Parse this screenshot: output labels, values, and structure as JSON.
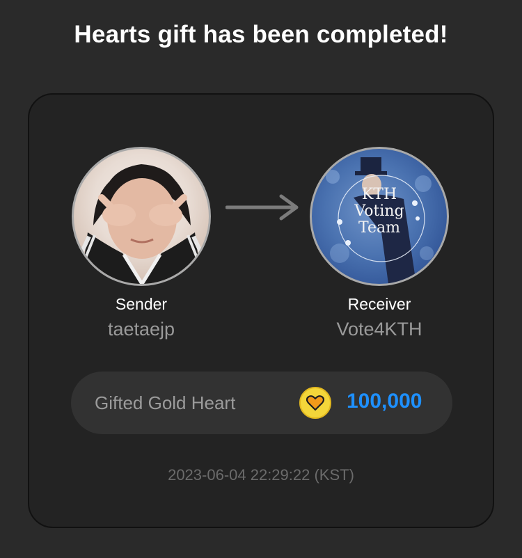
{
  "header": {
    "title": "Hearts gift has been completed!"
  },
  "sender": {
    "label": "Sender",
    "name": "taetaejp"
  },
  "receiver": {
    "label": "Receiver",
    "name": "Vote4KTH",
    "avatar_text_lines": [
      "KTH",
      "Voting",
      "Team"
    ]
  },
  "gift": {
    "label": "Gifted Gold Heart",
    "amount": "100,000",
    "icon": "gold-heart-coin-icon"
  },
  "timestamp": "2023-06-04 22:29:22 (KST)",
  "colors": {
    "background": "#2a2a2a",
    "card": "#232323",
    "amount": "#1e90ff",
    "coin": "#f4d63a",
    "heart": "#f39a1a"
  }
}
